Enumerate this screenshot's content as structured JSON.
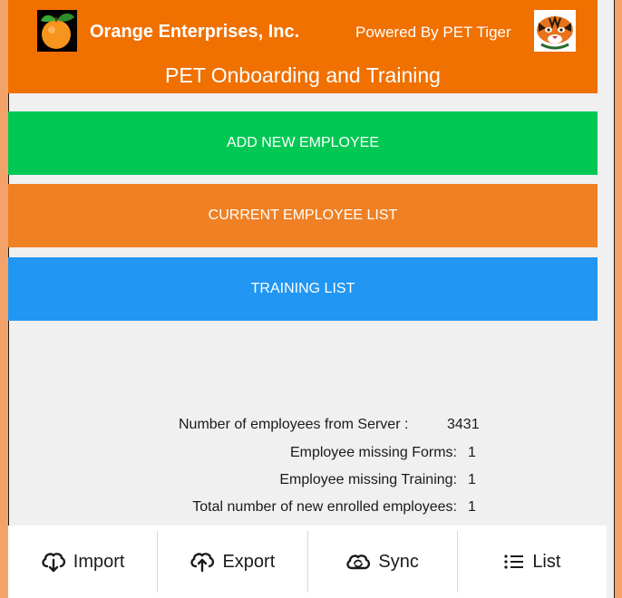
{
  "header": {
    "company_name": "Orange Enterprises, Inc.",
    "powered_by": "Powered By PET Tiger",
    "app_title": "PET Onboarding and Training",
    "logo_icon": "orange-fruit-logo",
    "tiger_icon": "tiger-face-logo",
    "background_color": "#f07000"
  },
  "buttons": {
    "add_new_employee": "ADD NEW EMPLOYEE",
    "current_employee_list": "CURRENT EMPLOYEE LIST",
    "training_list": "TRAINING LIST",
    "colors": {
      "add": "#00c853",
      "current": "#f08024",
      "training": "#2196f3"
    }
  },
  "stats": {
    "server_label": "Number of employees from Server :",
    "server_value": "3431",
    "missing_forms_label": "Employee missing Forms:",
    "missing_forms_value": "1",
    "missing_training_label": "Employee missing Training:",
    "missing_training_value": "1",
    "new_enrolled_label": "Total number of new enrolled employees:",
    "new_enrolled_value": "1"
  },
  "bottom_bar": {
    "import_label": "Import",
    "import_icon": "cloud-download-icon",
    "export_label": "Export",
    "export_icon": "cloud-upload-icon",
    "sync_label": "Sync",
    "sync_icon": "cloud-sync-icon",
    "list_label": "List",
    "list_icon": "list-icon"
  }
}
